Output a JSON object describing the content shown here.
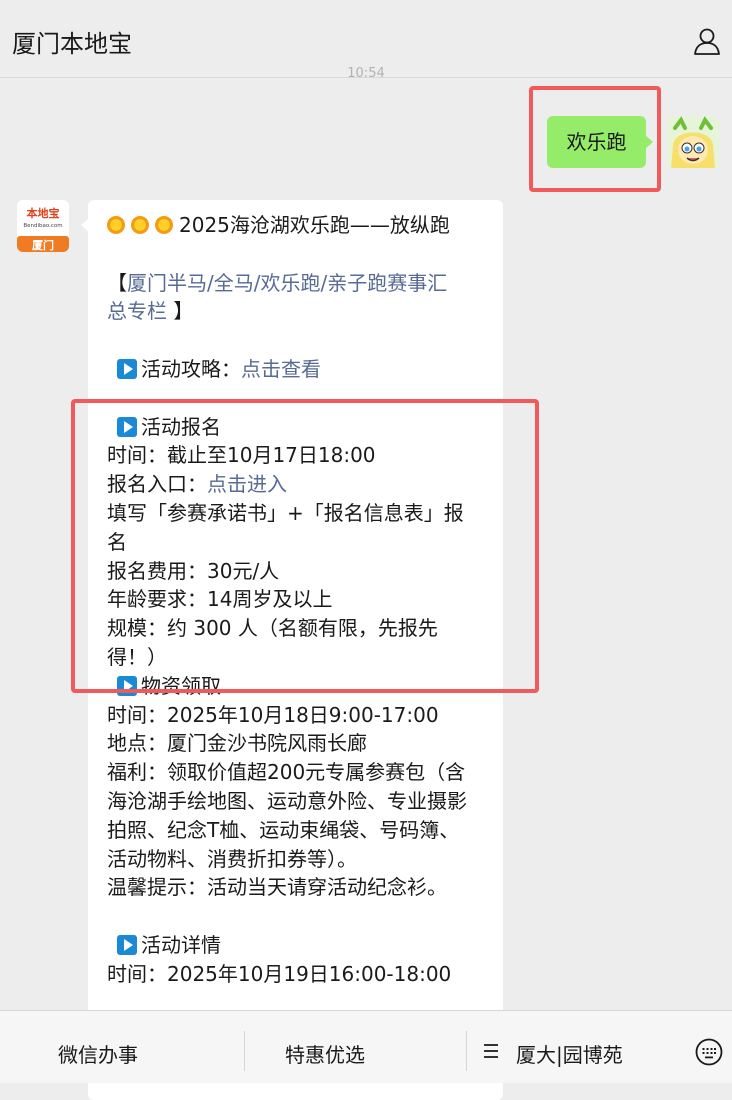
{
  "header": {
    "title": "厦门本地宝"
  },
  "timestamp": "10:54",
  "user_message": "欢乐跑",
  "bot_logo": {
    "top": "本地宝",
    "domain": "Bendibao.com",
    "city": "厦门"
  },
  "bot_message": {
    "title": "2025海沧湖欢乐跑——放纵跑",
    "column_open": "【",
    "column_link_1": "厦门半马/全马/欢乐跑/亲子跑赛事汇",
    "column_link_2": "总专栏",
    "column_close": " 】",
    "guide_label": "活动攻略：",
    "guide_link": "点击查看",
    "signup_header": "活动报名",
    "signup_lines": [
      "时间：截止至10月17日18:00"
    ],
    "entry_label": "报名入口：",
    "entry_link": "点击进入",
    "signup_lines_2": [
      "填写「参赛承诺书」+「报名信息表」报",
      "名",
      "报名费用：30元/人",
      "年龄要求：14周岁及以上",
      "规模：约 300 人（名额有限，先报先",
      "得！）"
    ],
    "pickup_header": "物资领取",
    "pickup_lines": [
      "时间：2025年10月18日9:00-17:00",
      "地点：厦门金沙书院风雨长廊",
      "福利：领取价值超200元专属参赛包（含",
      "海沧湖手绘地图、运动意外险、专业摄影",
      "拍照、纪念T桖、运动束绳袋、号码簿、",
      "活动物料、消费折扣券等）。",
      "温馨提示：活动当天请穿活动纪念衫。"
    ],
    "details_header": "活动详情",
    "details_lines": [
      "时间：2025年10月19日16:00-18:00"
    ]
  },
  "bottom_bar": {
    "tab1": "微信办事",
    "tab2": "特惠优选",
    "tab3": "厦大|园博苑"
  },
  "colors": {
    "highlight": "#f15a5a",
    "user_bubble": "#95ec69",
    "link": "#576b95",
    "play_icon": "#1b8ad6"
  }
}
